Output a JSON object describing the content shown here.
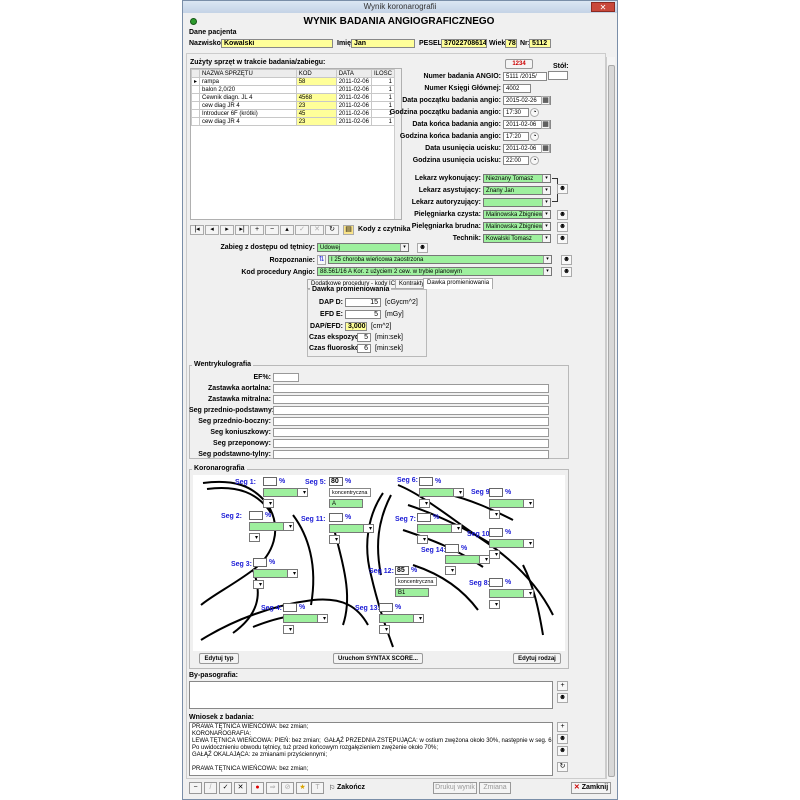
{
  "window": {
    "title": "Wynik koronarografii",
    "close": "✕"
  },
  "header": {
    "title": "WYNIK BADANIA ANGIOGRAFICZNEGO"
  },
  "patient": {
    "section": "Dane pacjenta",
    "surname_label": "Nazwisko:",
    "surname": "Kowalski",
    "name_label": "Imię:",
    "name": "Jan",
    "pesel_label": "PESEL:",
    "pesel": "37022708614",
    "age_label": "Wiek:",
    "age": "78",
    "nr_label": "Nr:",
    "nr": "5112"
  },
  "equipment": {
    "title": "Zużyty sprzęt w trakcie badania/zabiegu:",
    "columns": [
      "NAZWA SPRZĘTU",
      "KOD",
      "DATA",
      "ILOŚĆ"
    ],
    "rows": [
      [
        "rampa",
        "58",
        "2011-02-06",
        "1"
      ],
      [
        "balon 2,0/20",
        "",
        "2011-02-06",
        "1"
      ],
      [
        "Cewnik diagn. JL 4",
        "4568",
        "2011-02-06",
        "1"
      ],
      [
        "cew diag JR 4",
        "23",
        "2011-02-06",
        "1"
      ],
      [
        "Introducer 6F (krótki)",
        "45",
        "2011-02-06",
        "1"
      ],
      [
        "cew diag JR 4",
        "23",
        "2011-02-06",
        "1"
      ]
    ],
    "kody_button": "Kody z czytnika",
    "nav": [
      "|◂",
      "◂",
      "▸",
      "▸|",
      "+",
      "−",
      "▴",
      "✓",
      "✕",
      "↻"
    ]
  },
  "exam": {
    "stol_label": "Stół:",
    "nr_badania_label": "Numer badania ANGIO:",
    "nr_badania": "5111 /2015/",
    "nr_ksiegi_label": "Numer Księgi Głównej:",
    "nr_ksiegi": "4002",
    "data_pocz_label": "Data początku badania angio:",
    "data_pocz": "2015-02-26",
    "godz_pocz_label": "Godzina początku badania angio:",
    "godz_pocz": "17:30",
    "data_konca_label": "Data końca badania angio:",
    "data_konca": "2011-02-06",
    "godz_konca_label": "Godzina końca badania angio:",
    "godz_konca": "17:20",
    "data_usun_label": "Data usunięcia ucisku:",
    "data_usun": "2011-02-06",
    "godz_usun_label": "Godzina usunięcia ucisku:",
    "godz_usun": "22:00",
    "print_btn": "1234"
  },
  "staff": {
    "lek_wyk_label": "Lekarz wykonujący:",
    "lek_wyk": "Nieznany Tomasz",
    "lek_asy_label": "Lekarz asystujący:",
    "lek_asy": "Znany Jan",
    "lek_aut_label": "Lekarz autoryzujący:",
    "lek_aut": "",
    "piel_czysta_label": "Pielęgniarka czysta:",
    "piel_czysta": "Malinowska Zbigniewa",
    "piel_brudna_label": "Pielęgniarka brudna:",
    "piel_brudna": "Malinowska Zbigniewa",
    "technik_label": "Technik:",
    "technik": "Kowalski Tomasz"
  },
  "procedure": {
    "dostep_label": "Zabieg z dostępu od tętnicy:",
    "dostep": "Udowej",
    "rozpoznanie_label": "Rozpoznanie:",
    "rozpoznanie": "I 25  choroba wieńcowa zaostrzona",
    "kod_label": "Kod procedury Angio:",
    "kod": "88.561/16  A Kor. z użyciem 2 cew. w trybie planowym"
  },
  "tabs": [
    "Dodatkowe procedury - kody ICD-9",
    "Kontrakty",
    "Dawka promieniowania"
  ],
  "dose": {
    "title": "Dawka promieniowania",
    "dap_label": "DAP D:",
    "dap": "15",
    "dap_unit": "[cGycm^2]",
    "efd_label": "EFD E:",
    "efd": "5",
    "efd_unit": "[mGy]",
    "ratio_label": "DAP/EFD:",
    "ratio": "3,000",
    "ratio_unit": "[cm^2]",
    "czas_eksp_label": "Czas ekspozycji:",
    "czas_eksp": "5",
    "czas_eksp_unit": "[min:sek]",
    "czas_fluo_label": "Czas fluoroskopii:",
    "czas_fluo": "6",
    "czas_fluo_unit": "[min:sek]"
  },
  "vent": {
    "title": "Wentrykulografia",
    "ef_label": "EF%:",
    "rows": [
      "Zastawka aortalna:",
      "Zastawka mitralna:",
      "Seg przednio-podstawny:",
      "Seg przednio-boczny:",
      "Seg koniuszkowy:",
      "Seg przeponowy:",
      "Seg podstawno-tylny:"
    ]
  },
  "coro": {
    "title": "Koronarografia",
    "segs": [
      "Seg 1:",
      "Seg 5:",
      "Seg 6:",
      "Seg 9:",
      "Seg 2:",
      "Seg 11:",
      "Seg 7:",
      "Seg 10:",
      "Seg 14:",
      "Seg 3:",
      "Seg 12:",
      "Seg 8:",
      "Seg 4:",
      "Seg 13:"
    ],
    "pct": "%",
    "seg5_val": "80",
    "seg5_type": "koncentryczna",
    "seg5_sub": "A",
    "seg12_val": "85",
    "seg12_type": "koncentryczna",
    "seg12_sub": "B1",
    "edit_typ": "Edytuj typ",
    "syntax": "Uruchom SYNTAX SCORE...",
    "edit_rodzaj": "Edytuj rodzaj"
  },
  "bypass": {
    "title": "By-pasografia:"
  },
  "conclusion": {
    "title": "Wniosek z badania:",
    "text": "PRAWA TĘTNICA WIEŃCOWA: bez zmian;\nKORONAROGRAFIA:\nLEWA TĘTNICA WIEŃCOWA: PIEŃ: bez zmian;  GAŁĄŹ PRZEDNIA ZSTĘPUJĄCA: w ostium zwężona około 30%, następnie w seg. 6 niedrożna.\nPo uwidocznieniu obwodu tętnicy, tuż przed końcowym rozgałęzieniem zwężenie około 70%;\nGAŁĄŹ OKALAJĄCA: ze zmianami przyściennymi;\n\nPRAWA TĘTNICA WIEŃCOWA: bez zmian;"
  },
  "bottom": {
    "zakoncz": "Zakończ",
    "drukuj": "Drukuj wynik",
    "zmien": "Zmiana",
    "zamknij": "Zamknij"
  },
  "colors": {
    "yellow": "#ffff99",
    "green": "#9ef09e",
    "accent": "#1a1ad6"
  }
}
